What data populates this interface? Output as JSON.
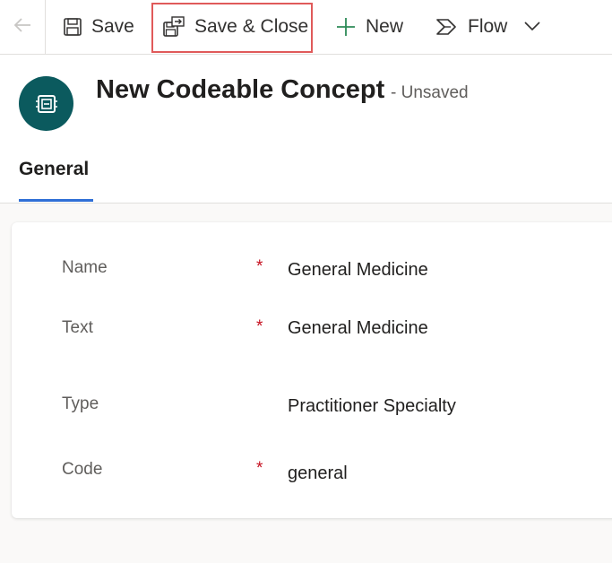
{
  "toolbar": {
    "back_icon": "back-arrow-icon",
    "save_label": "Save",
    "save_close_label": "Save & Close",
    "new_label": "New",
    "flow_label": "Flow"
  },
  "header": {
    "title": "New Codeable Concept",
    "status": "- Unsaved",
    "entity_icon": "codeable-concept-icon",
    "icon_color": "#0b5a5e"
  },
  "tabs": [
    {
      "label": "General",
      "active": true
    }
  ],
  "fields": [
    {
      "label": "Name",
      "required": true,
      "required_mark": "*",
      "value": "General Medicine"
    },
    {
      "label": "Text",
      "required": true,
      "required_mark": "*",
      "value": "General Medicine"
    },
    {
      "label": "Type",
      "required": false,
      "required_mark": "",
      "value": "Practitioner Specialty"
    },
    {
      "label": "Code",
      "required": true,
      "required_mark": "*",
      "value": "general"
    }
  ],
  "colors": {
    "accent": "#2f6fd6",
    "required": "#c50f1f",
    "highlight_border": "#e05a5a",
    "new_icon": "#2e8b57"
  }
}
